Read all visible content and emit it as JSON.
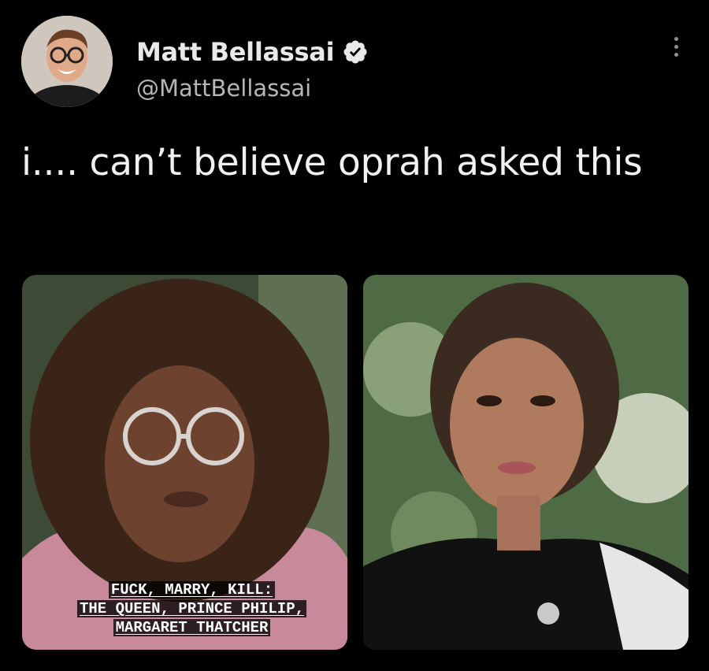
{
  "tweet": {
    "display_name": "Matt Bellassai",
    "handle": "@MattBellassai",
    "text": "i.... can’t believe oprah asked this",
    "verified": true
  },
  "media": {
    "caption_lines": [
      "FUCK, MARRY, KILL:",
      "THE QUEEN, PRINCE PHILIP,",
      "MARGARET THATCHER"
    ]
  },
  "icons": {
    "verified": "verified-badge-icon",
    "more": "more-options-icon"
  },
  "colors": {
    "background": "#000000",
    "text": "#e7e9ea",
    "secondary_text": "#b4b7ba"
  }
}
